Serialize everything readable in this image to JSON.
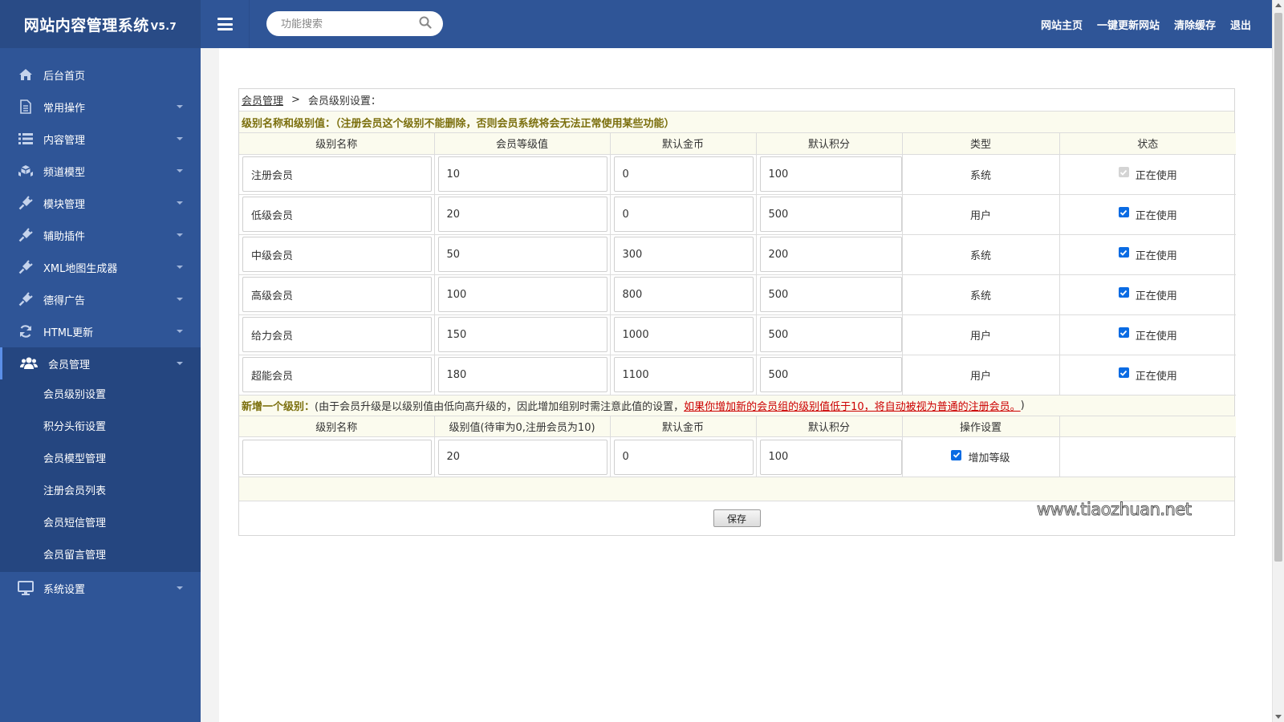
{
  "header": {
    "logo_text": "网站内容管理系统",
    "version": "V5.7",
    "search_placeholder": "功能搜索",
    "links": [
      "网站主页",
      "一键更新网站",
      "清除缓存",
      "退出"
    ]
  },
  "sidebar": {
    "items": [
      {
        "label": "后台首页",
        "icon": "home-icon"
      },
      {
        "label": "常用操作",
        "icon": "document-icon"
      },
      {
        "label": "内容管理",
        "icon": "list-icon"
      },
      {
        "label": "频道模型",
        "icon": "cubes-icon"
      },
      {
        "label": "模块管理",
        "icon": "plug-icon"
      },
      {
        "label": "辅助插件",
        "icon": "plug-icon"
      },
      {
        "label": "XML地图生成器",
        "icon": "plug-icon"
      },
      {
        "label": "德得广告",
        "icon": "plug-icon"
      },
      {
        "label": "HTML更新",
        "icon": "refresh-icon"
      },
      {
        "label": "会员管理",
        "icon": "users-icon"
      },
      {
        "label": "系统设置",
        "icon": "desktop-icon"
      }
    ],
    "sub_items": [
      "会员级别设置",
      "积分头衔设置",
      "会员模型管理",
      "注册会员列表",
      "会员短信管理",
      "会员留言管理"
    ]
  },
  "page": {
    "breadcrumb_link": "会员管理",
    "breadcrumb_sep": ">",
    "breadcrumb_current": "会员级别设置：",
    "notice": "级别名称和级别值：（注册会员这个级别不能删除，否则会员系统将会无法正常使用某些功能）",
    "columns": [
      "级别名称",
      "会员等级值",
      "默认金币",
      "默认积分",
      "类型",
      "状态"
    ],
    "rows": [
      {
        "name": "注册会员",
        "level": "10",
        "gold": "0",
        "points": "100",
        "type": "系统",
        "status": "正在使用",
        "checked": true,
        "disabled": true
      },
      {
        "name": "低级会员",
        "level": "20",
        "gold": "0",
        "points": "500",
        "type": "用户",
        "status": "正在使用",
        "checked": true,
        "disabled": false
      },
      {
        "name": "中级会员",
        "level": "50",
        "gold": "300",
        "points": "200",
        "type": "系统",
        "status": "正在使用",
        "checked": true,
        "disabled": false
      },
      {
        "name": "高级会员",
        "level": "100",
        "gold": "800",
        "points": "500",
        "type": "系统",
        "status": "正在使用",
        "checked": true,
        "disabled": false
      },
      {
        "name": "给力会员",
        "level": "150",
        "gold": "1000",
        "points": "500",
        "type": "用户",
        "status": "正在使用",
        "checked": true,
        "disabled": false
      },
      {
        "name": "超能会员",
        "level": "180",
        "gold": "1100",
        "points": "500",
        "type": "用户",
        "status": "正在使用",
        "checked": true,
        "disabled": false
      }
    ],
    "new_section": {
      "lead": "新增一个级别：",
      "text": "(由于会员升级是以级别值由低向高升级的，因此增加组别时需注意此值的设置，",
      "warning": "如果你增加新的会员组的级别值低于10，将自动被视为普通的注册会员。",
      "tail": ")",
      "columns": [
        "级别名称",
        "级别值(待审为0,注册会员为10)",
        "默认金币",
        "默认积分",
        "操作设置",
        ""
      ],
      "name_value": "",
      "level_value": "20",
      "gold_value": "0",
      "points_value": "100",
      "add_label": "增加等级"
    },
    "save_label": "保存"
  },
  "watermark": "www.tiaozhuan.net",
  "colors": {
    "header_bg": "#2f5597",
    "sidebar_active": "#254680",
    "notice_text": "#7b6f0d",
    "warning_text": "#cc0000",
    "checkbox": "#0a6be3"
  }
}
